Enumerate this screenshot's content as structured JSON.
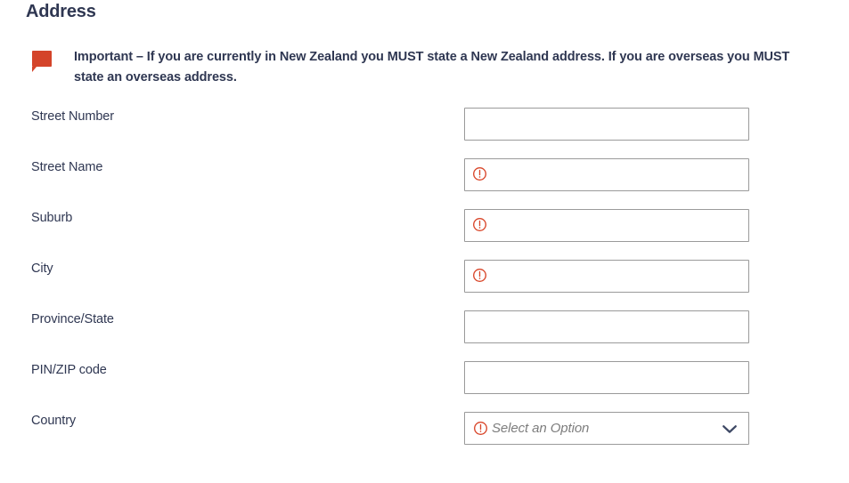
{
  "section": {
    "title": "Address"
  },
  "callout": {
    "icon": "speech-bubble-icon",
    "text": "Important – If you are currently in New Zealand you MUST state a New Zealand address. If you are overseas you MUST state an overseas address."
  },
  "form": {
    "error_icon_name": "error-exclamation-icon",
    "fields": [
      {
        "label": "Street Number",
        "type": "text",
        "value": "",
        "placeholder": "",
        "error": false
      },
      {
        "label": "Street Name",
        "type": "text",
        "value": "",
        "placeholder": "",
        "error": true
      },
      {
        "label": "Suburb",
        "type": "text",
        "value": "",
        "placeholder": "",
        "error": true
      },
      {
        "label": "City",
        "type": "text",
        "value": "",
        "placeholder": "",
        "error": true
      },
      {
        "label": "Province/State",
        "type": "text",
        "value": "",
        "placeholder": "",
        "error": false
      },
      {
        "label": "PIN/ZIP code",
        "type": "text",
        "value": "",
        "placeholder": "",
        "error": false
      },
      {
        "label": "Country",
        "type": "select",
        "value": "Select an Option",
        "placeholder": "Select an Option",
        "error": true
      }
    ]
  },
  "colors": {
    "heading": "#2f3752",
    "text": "#2f3752",
    "accent_red": "#d4442a",
    "error_red": "#d9472b",
    "input_border": "#9a9a9a",
    "placeholder": "#7d7d7d",
    "background": "#ffffff"
  }
}
